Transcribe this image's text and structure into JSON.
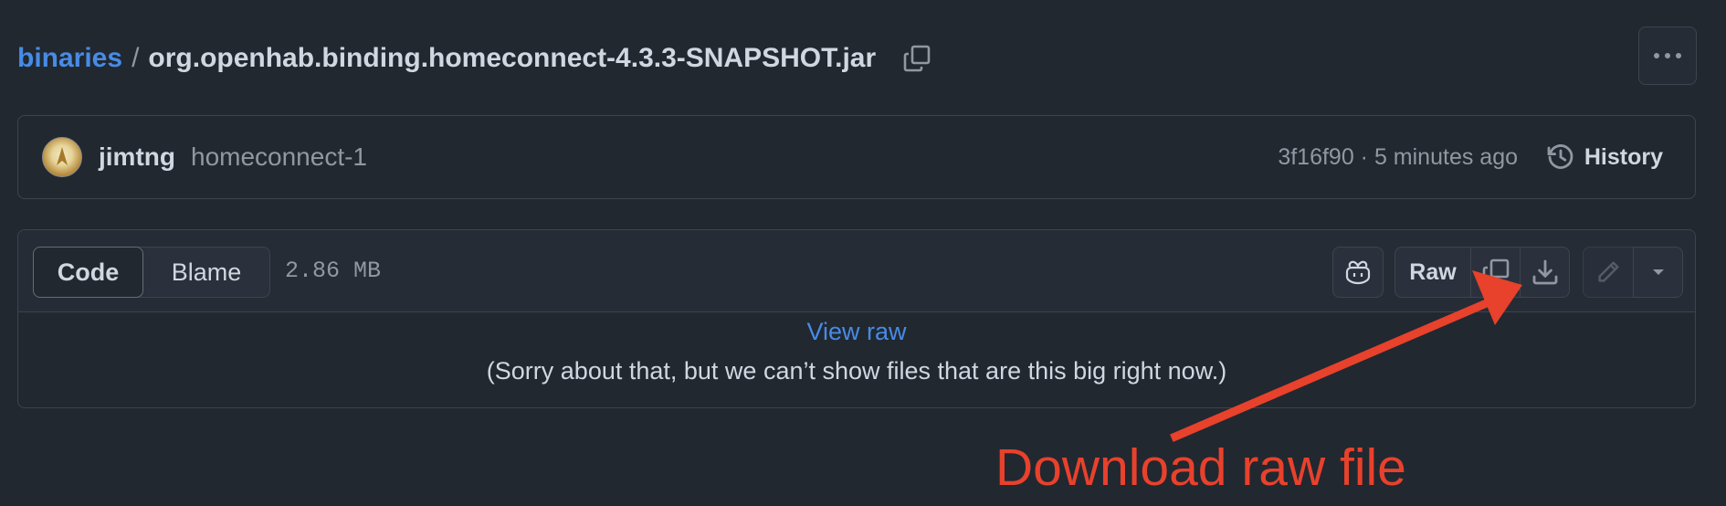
{
  "breadcrumb": {
    "repo": "binaries",
    "separator": "/",
    "file": "org.openhab.binding.homeconnect-4.3.3-SNAPSHOT.jar"
  },
  "commit": {
    "author": "jimtng",
    "branch": "homeconnect-1",
    "meta": "3f16f90 · 5 minutes ago",
    "history_label": "History"
  },
  "file_view": {
    "tab_code": "Code",
    "tab_blame": "Blame",
    "size": "2.86 MB",
    "raw_label": "Raw",
    "view_raw": "View raw",
    "message": "(Sorry about that, but we can’t show files that are this big right now.)"
  },
  "annotation": {
    "text": "Download raw file",
    "color": "#e8412c"
  },
  "colors": {
    "background": "#212830",
    "link": "#478be6",
    "border": "#3d444d",
    "muted": "#9198a1"
  },
  "icons": [
    "copy-icon",
    "kebab-horizontal-icon",
    "history-icon",
    "copilot-icon",
    "download-icon",
    "pencil-icon",
    "triangle-down-icon"
  ]
}
